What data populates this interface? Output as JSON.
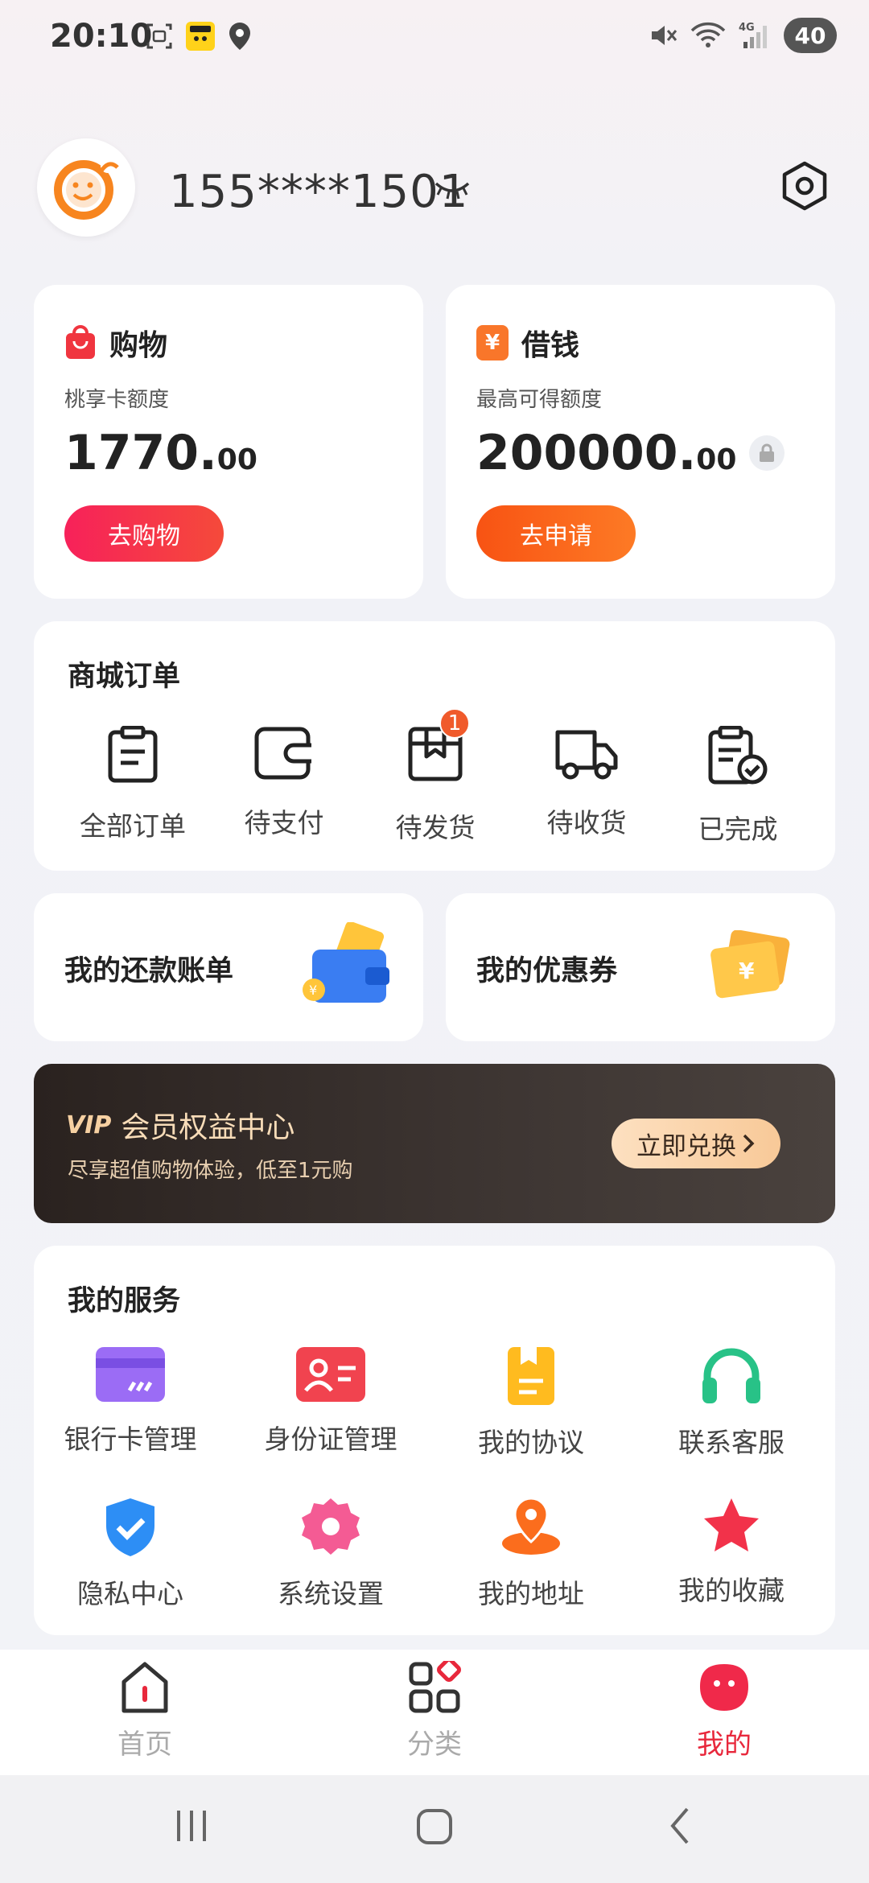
{
  "status": {
    "time": "20:10",
    "battery": "40",
    "network": "4G"
  },
  "profile": {
    "phone": "155****1501"
  },
  "finance": [
    {
      "title": "购物",
      "badge": "",
      "subtitle": "桃享卡额度",
      "amount_int": "1770.",
      "amount_dec": "00",
      "button": "去购物",
      "color": "#f03a48"
    },
    {
      "title": "借钱",
      "badge": "¥",
      "subtitle": "最高可得额度",
      "amount_int": "200000.",
      "amount_dec": "00",
      "button": "去申请",
      "color": "#fb6a1c"
    }
  ],
  "orders": {
    "title": "商城订单",
    "items": [
      {
        "label": "全部订单",
        "icon": "clipboard-icon"
      },
      {
        "label": "待支付",
        "icon": "wallet-icon"
      },
      {
        "label": "待发货",
        "icon": "package-icon",
        "badge": "1"
      },
      {
        "label": "待收货",
        "icon": "truck-icon"
      },
      {
        "label": "已完成",
        "icon": "clipboard-check-icon"
      }
    ]
  },
  "mini_cards": [
    {
      "title": "我的还款账单",
      "icon": "wallet-bill-icon"
    },
    {
      "title": "我的优惠券",
      "icon": "coupon-icon"
    }
  ],
  "vip": {
    "logo": "VIP",
    "title": "会员权益中心",
    "subtitle": "尽享超值购物体验，低至1元购",
    "button": "立即兑换"
  },
  "services": {
    "title": "我的服务",
    "items": [
      {
        "label": "银行卡管理",
        "icon": "bank-card-icon"
      },
      {
        "label": "身份证管理",
        "icon": "id-card-icon"
      },
      {
        "label": "我的协议",
        "icon": "agreement-icon"
      },
      {
        "label": "联系客服",
        "icon": "headset-icon"
      },
      {
        "label": "隐私中心",
        "icon": "shield-check-icon"
      },
      {
        "label": "系统设置",
        "icon": "gear-icon"
      },
      {
        "label": "我的地址",
        "icon": "location-pin-icon"
      },
      {
        "label": "我的收藏",
        "icon": "star-icon"
      }
    ]
  },
  "tabs": [
    {
      "label": "首页",
      "icon": "home-icon"
    },
    {
      "label": "分类",
      "icon": "category-icon"
    },
    {
      "label": "我的",
      "icon": "profile-face-icon",
      "active": true
    }
  ]
}
